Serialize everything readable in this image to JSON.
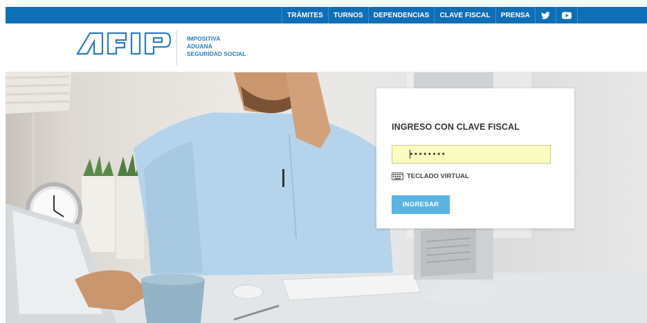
{
  "nav": {
    "items": [
      "TRÁMITES",
      "TURNOS",
      "DEPENDENCIAS",
      "CLAVE FISCAL",
      "PRENSA"
    ],
    "social": [
      "twitter-icon",
      "youtube-icon"
    ],
    "bar_color": "#0e6fb7"
  },
  "header": {
    "logo_text": "AFIP",
    "tagline": [
      "IMPOSITIVA",
      "ADUANA",
      "SEGURIDAD SOCIAL"
    ],
    "brand_color": "#2a7dc1"
  },
  "login": {
    "title": "INGRESO CON CLAVE FISCAL",
    "password_value": "••••••••",
    "virtual_keyboard_label": "TECLADO VIRTUAL",
    "keyboard_icon": "keyboard-icon",
    "submit_label": "INGRESAR",
    "input_bg": "#fbfcbf",
    "button_color": "#5bb3df"
  }
}
